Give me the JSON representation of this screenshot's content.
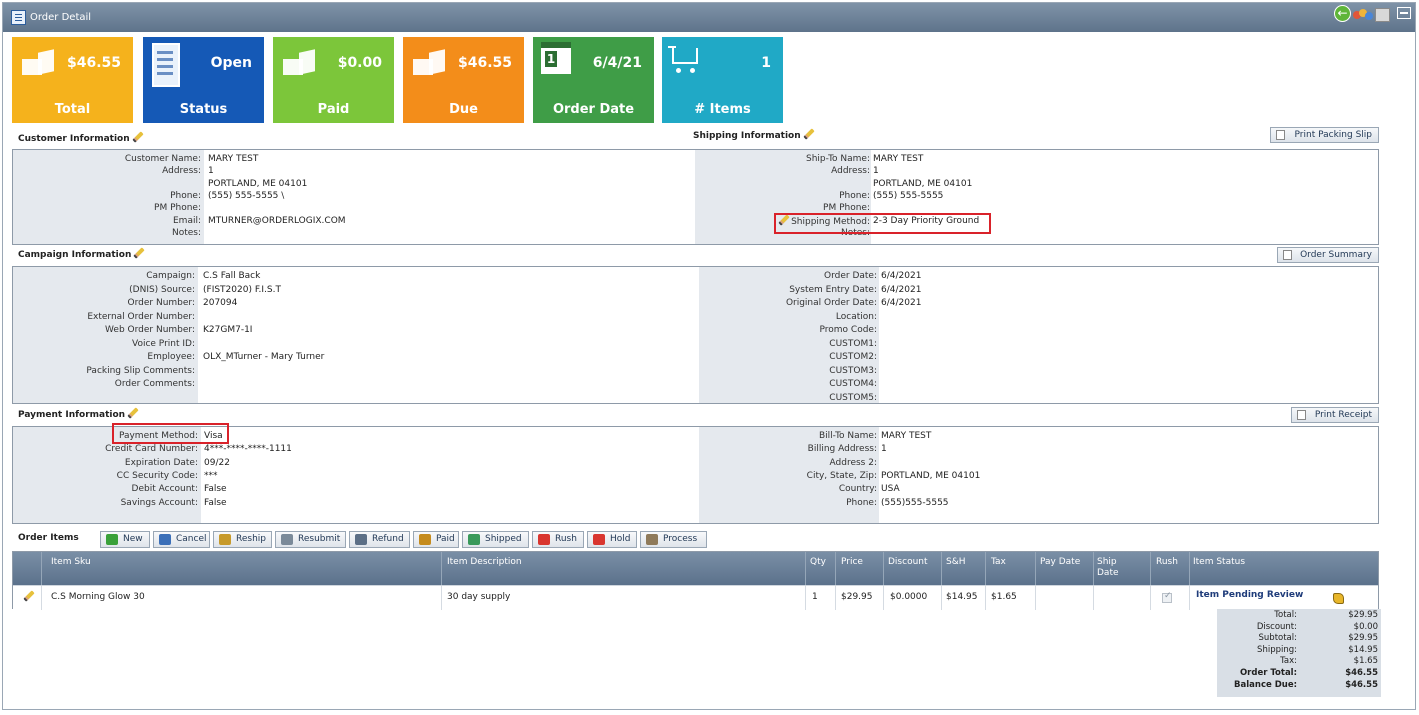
{
  "window": {
    "title": "Order Detail"
  },
  "kpis": [
    {
      "value": "$46.55",
      "label": "Total"
    },
    {
      "value": "Open",
      "label": "Status"
    },
    {
      "value": "$0.00",
      "label": "Paid"
    },
    {
      "value": "$46.55",
      "label": "Due"
    },
    {
      "value": "6/4/21",
      "label": "Order Date",
      "calendar_day": "1"
    },
    {
      "value": "1",
      "label": "# Items"
    }
  ],
  "customer": {
    "title": "Customer Information",
    "rows": [
      {
        "k": "Customer Name:",
        "v": "MARY TEST"
      },
      {
        "k": "Address:",
        "v": "1"
      },
      {
        "k": "",
        "v": "PORTLAND, ME 04101"
      },
      {
        "k": "Phone:",
        "v": "(555) 555-5555 \\"
      },
      {
        "k": "PM Phone:",
        "v": ""
      },
      {
        "k": "Email:",
        "v": "MTURNER@ORDERLOGIX.COM"
      },
      {
        "k": "Notes:",
        "v": ""
      }
    ]
  },
  "shipping": {
    "title": "Shipping Information",
    "print_label": "Print Packing Slip",
    "rows": [
      {
        "k": "Ship-To Name:",
        "v": "MARY TEST"
      },
      {
        "k": "Address:",
        "v": "1"
      },
      {
        "k": "",
        "v": "PORTLAND, ME 04101"
      },
      {
        "k": "Phone:",
        "v": "(555) 555-5555"
      },
      {
        "k": "PM Phone:",
        "v": ""
      },
      {
        "k": "Shipping Method:",
        "v": "2-3 Day Priority Ground"
      },
      {
        "k": "Notes:",
        "v": ""
      }
    ]
  },
  "campaign": {
    "title": "Campaign Information",
    "summary_label": "Order Summary",
    "left": [
      {
        "k": "Campaign:",
        "v": "C.S Fall Back"
      },
      {
        "k": "(DNIS) Source:",
        "v": "(FIST2020) F.I.S.T"
      },
      {
        "k": "Order Number:",
        "v": "207094"
      },
      {
        "k": "External Order Number:",
        "v": ""
      },
      {
        "k": "Web Order Number:",
        "v": "K27GM7-1I"
      },
      {
        "k": "Voice Print ID:",
        "v": ""
      },
      {
        "k": "Employee:",
        "v": "OLX_MTurner - Mary Turner"
      },
      {
        "k": "Packing Slip Comments:",
        "v": ""
      },
      {
        "k": "Order Comments:",
        "v": ""
      }
    ],
    "right": [
      {
        "k": "Order Date:",
        "v": "6/4/2021"
      },
      {
        "k": "System Entry Date:",
        "v": "6/4/2021"
      },
      {
        "k": "Original Order Date:",
        "v": "6/4/2021"
      },
      {
        "k": "Location:",
        "v": ""
      },
      {
        "k": "Promo Code:",
        "v": ""
      },
      {
        "k": "CUSTOM1:",
        "v": ""
      },
      {
        "k": "CUSTOM2:",
        "v": ""
      },
      {
        "k": "CUSTOM3:",
        "v": ""
      },
      {
        "k": "CUSTOM4:",
        "v": ""
      },
      {
        "k": "CUSTOM5:",
        "v": ""
      }
    ]
  },
  "payment": {
    "title": "Payment Information",
    "receipt_label": "Print Receipt",
    "left": [
      {
        "k": "Payment Method:",
        "v": "Visa"
      },
      {
        "k": "Credit Card Number:",
        "v": "4***-****-****-1111"
      },
      {
        "k": "Expiration Date:",
        "v": "09/22"
      },
      {
        "k": "CC Security Code:",
        "v": "***"
      },
      {
        "k": "Debit Account:",
        "v": "False"
      },
      {
        "k": "Savings Account:",
        "v": "False"
      }
    ],
    "right": [
      {
        "k": "Bill-To Name:",
        "v": "MARY TEST"
      },
      {
        "k": "Billing Address:",
        "v": "1"
      },
      {
        "k": "Address 2:",
        "v": ""
      },
      {
        "k": "City, State, Zip:",
        "v": "PORTLAND, ME 04101"
      },
      {
        "k": "Country:",
        "v": "USA"
      },
      {
        "k": "Phone:",
        "v": "(555)555-5555"
      }
    ]
  },
  "order_items": {
    "title": "Order Items",
    "actions": [
      "New",
      "Cancel",
      "Reship",
      "Resubmit",
      "Refund",
      "Paid",
      "Shipped",
      "Rush",
      "Hold",
      "Process"
    ],
    "columns": [
      "Item Sku",
      "Item Description",
      "Qty",
      "Price",
      "Discount",
      "S&H",
      "Tax",
      "Pay Date",
      "Ship Date",
      "Rush",
      "Item Status"
    ],
    "rows": [
      {
        "sku": "C.S Morning Glow 30",
        "desc": "30 day supply",
        "qty": "1",
        "price": "$29.95",
        "discount": "$0.0000",
        "sh": "$14.95",
        "tax": "$1.65",
        "pay_date": "",
        "ship_date": "",
        "rush": true,
        "status": "Item Pending Review"
      }
    ]
  },
  "totals": [
    {
      "k": "Total:",
      "v": "$29.95"
    },
    {
      "k": "Discount:",
      "v": "$0.00"
    },
    {
      "k": "Subtotal:",
      "v": "$29.95"
    },
    {
      "k": "Shipping:",
      "v": "$14.95"
    },
    {
      "k": "Tax:",
      "v": "$1.65"
    },
    {
      "k": "Order Total:",
      "v": "$46.55",
      "bold": true
    },
    {
      "k": "Balance Due:",
      "v": "$46.55",
      "bold": true
    }
  ],
  "colors": {
    "total": "#f5b21c",
    "status": "#1559b6",
    "paid": "#7cc63a",
    "due": "#f38d1a",
    "order_date": "#3f9d47",
    "items": "#20a9c6",
    "highlight": "#d9222a",
    "status_link": "#1f3c7a"
  }
}
